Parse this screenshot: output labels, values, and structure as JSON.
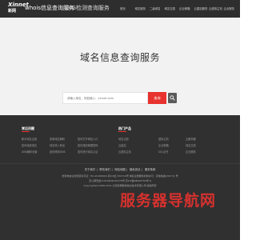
{
  "header": {
    "logo_line1": "Xinnet",
    "logo_line2": "新网",
    "tab_whois": "whois信息查询服务",
    "tab_dig": "DIG检测查询服务",
    "nav": [
      "首页",
      "域名服务",
      "二级域名",
      "域名交易",
      "企业邮箱",
      "云建站服务",
      "云虚拟主机",
      "企业服务"
    ]
  },
  "hero": {
    "title": "域名信息查询服务",
    "search_placeholder": "请输入域名，例如输入：xinnet.com",
    "search_button": "查询"
  },
  "footer": {
    "col1_title": "常见问题",
    "col1_links": [
      [
        "新手域名注册",
        "查看域名解析",
        "如何打开网站入口"
      ],
      [
        "如何续费域名",
        "域名转入转出",
        "如何找回管理密码"
      ],
      [
        "DNS解析设置",
        "如何修改DNS",
        "如何进行域名认证"
      ]
    ],
    "col2_title": "热门产品",
    "col2_links": [
      [
        "域名注册",
        "虚拟主机",
        "云服务器"
      ],
      [
        "云建站",
        "企业邮箱",
        "域名交易"
      ],
      [
        "云虚拟主机",
        "SSL证书",
        "企业服务"
      ]
    ],
    "bottom_links": [
      "关于我们",
      "联系我们",
      "网站地图",
      "隐私协议",
      "服务条款"
    ],
    "info_line1": "增值电信业务经营许可证：B1-20180609 京ICP证 030719号 域名注册服务机构许可：京信信函[2017]1 号",
    "info_line2": "京公网安备11010802030376号 京ICP备08006750号-8",
    "copyright": "Copyright(C)1998-2021 北京新网数码信息技术有限公司 版权所有",
    "watermark": "服务器导航网"
  }
}
